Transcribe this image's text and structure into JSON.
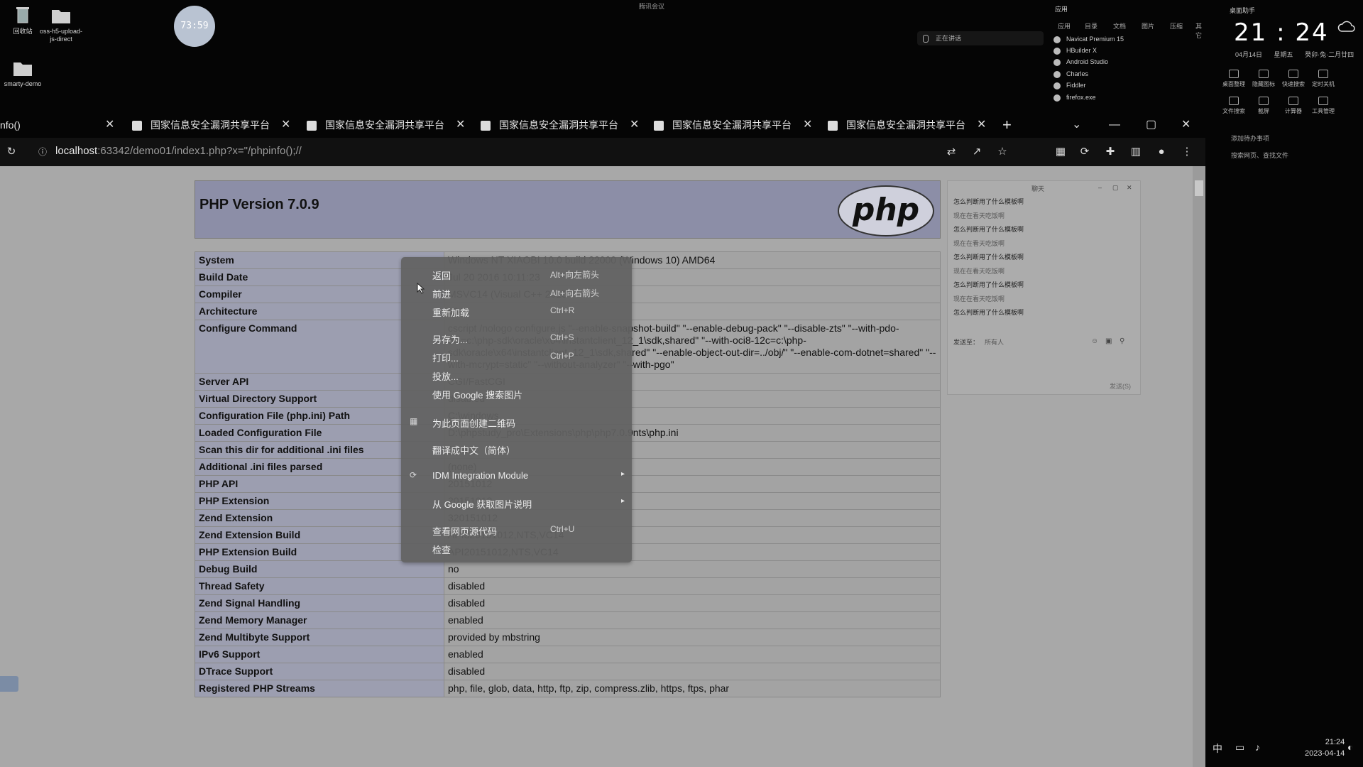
{
  "desktop": {
    "icons": [
      {
        "label": "回收站",
        "icon": "recycle-bin-icon"
      },
      {
        "label": "oss-h5-upload-js-direct",
        "icon": "folder-icon"
      },
      {
        "label": "smarty-demo",
        "icon": "folder-icon"
      }
    ],
    "timer": "73:59",
    "meeting_status": "腾讯会议",
    "sharing_status": "正在讲话"
  },
  "launcher": {
    "header": "应用",
    "tabs": [
      "应用",
      "目录",
      "文档",
      "图片",
      "压缩",
      "其它"
    ],
    "items": [
      "Navicat Premium 15",
      "HBuilder X",
      "Android Studio",
      "Charles",
      "Fiddler",
      "firefox.exe"
    ]
  },
  "right_panel": {
    "title": "桌面助手",
    "time": "21 : 24",
    "date": "04月14日",
    "weekday": "星期五",
    "lunar": "癸卯·兔·二月廿四",
    "tools_row1": [
      "桌面整理",
      "隐藏图标",
      "快速搜索",
      "定时关机"
    ],
    "tools_row2": [
      "文件搜索",
      "截屏",
      "计算器",
      "工具管理"
    ],
    "todo": "添加待办事项",
    "search": "搜索网页、查找文件"
  },
  "browser": {
    "first_tab": "nfo()",
    "tabs": [
      "国家信息安全漏洞共享平台",
      "国家信息安全漏洞共享平台",
      "国家信息安全漏洞共享平台",
      "国家信息安全漏洞共享平台",
      "国家信息安全漏洞共享平台"
    ],
    "new_tab": "+",
    "url_host": "localhost",
    "url_rest": ":63342/demo01/index1.php?x=\"/phpinfo();//"
  },
  "phpinfo": {
    "title": "PHP Version 7.0.9",
    "logo": "php",
    "rows": [
      {
        "k": "System",
        "v": "Windows NT XIAOBI 10.0 build 22000 (Windows 10) AMD64"
      },
      {
        "k": "Build Date",
        "v": "Jul 20 2016 10:11:23"
      },
      {
        "k": "Compiler",
        "v": "MSVC14 (Visual C++ 2015"
      },
      {
        "k": "Architecture",
        "v": "x64"
      },
      {
        "k": "Configure Command",
        "v": "cscript /nologo configure.js \"--enable-snapshot-build\" \"--enable-debug-pack\" \"--disable-zts\" \"--with-pdo-oci=c:\\php-sdk\\oracle\\x64\\instantclient_12_1\\sdk,shared\" \"--with-oci8-12c=c:\\php-sdk\\oracle\\x64\\instantclient_12_1\\sdk,shared\" \"--enable-object-out-dir=../obj/\" \"--enable-com-dotnet=shared\" \"--with-mcrypt=static\" \"--without-analyzer\" \"--with-pgo\""
      },
      {
        "k": "Server API",
        "v": "CGI/FastCGI"
      },
      {
        "k": "Virtual Directory Support",
        "v": "disabled"
      },
      {
        "k": "Configuration File (php.ini) Path",
        "v": "C:\\windows"
      },
      {
        "k": "Loaded Configuration File",
        "v": "D:\\phpstudy_pro\\Extensions\\php\\php7.0.9nts\\php.ini"
      },
      {
        "k": "Scan this dir for additional .ini files",
        "v": "(none)"
      },
      {
        "k": "Additional .ini files parsed",
        "v": "(none)"
      },
      {
        "k": "PHP API",
        "v": "20151012"
      },
      {
        "k": "PHP Extension",
        "v": "20151012"
      },
      {
        "k": "Zend Extension",
        "v": "320151012"
      },
      {
        "k": "Zend Extension Build",
        "v": "API320151012,NTS,VC14"
      },
      {
        "k": "PHP Extension Build",
        "v": "API20151012,NTS,VC14"
      },
      {
        "k": "Debug Build",
        "v": "no"
      },
      {
        "k": "Thread Safety",
        "v": "disabled"
      },
      {
        "k": "Zend Signal Handling",
        "v": "disabled"
      },
      {
        "k": "Zend Memory Manager",
        "v": "enabled"
      },
      {
        "k": "Zend Multibyte Support",
        "v": "provided by mbstring"
      },
      {
        "k": "IPv6 Support",
        "v": "enabled"
      },
      {
        "k": "DTrace Support",
        "v": "disabled"
      },
      {
        "k": "Registered PHP Streams",
        "v": "php, file, glob, data, http, ftp, zip, compress.zlib, https, ftps, phar"
      }
    ]
  },
  "chat": {
    "title": "聊天",
    "messages": [
      {
        "type": "q",
        "text": "怎么判断用了什么模板啊"
      },
      {
        "type": "a",
        "text": "现在在看天吃饭啊"
      },
      {
        "type": "q",
        "text": "怎么判断用了什么模板啊"
      },
      {
        "type": "a",
        "text": "现在在看天吃饭啊"
      },
      {
        "type": "q",
        "text": "怎么判断用了什么模板啊"
      },
      {
        "type": "a",
        "text": "现在在看天吃饭啊"
      },
      {
        "type": "q",
        "text": "怎么判断用了什么模板啊"
      },
      {
        "type": "a",
        "text": "现在在看天吃饭啊"
      },
      {
        "type": "q",
        "text": "怎么判断用了什么模板啊"
      }
    ],
    "send_to_label": "发送至：",
    "send_to_value": "所有人",
    "send_button": "发送(S)"
  },
  "context_menu": {
    "items": [
      {
        "label": "返回",
        "shortcut": "Alt+向左箭头"
      },
      {
        "label": "前进",
        "shortcut": "Alt+向右箭头"
      },
      {
        "label": "重新加载",
        "shortcut": "Ctrl+R"
      },
      {
        "label": "另存为...",
        "shortcut": "Ctrl+S"
      },
      {
        "label": "打印...",
        "shortcut": "Ctrl+P"
      },
      {
        "label": "投放...",
        "shortcut": ""
      },
      {
        "label": "使用 Google 搜索图片",
        "shortcut": ""
      },
      {
        "label": "为此页面创建二维码",
        "shortcut": ""
      },
      {
        "label": "翻译成中文（简体）",
        "shortcut": ""
      },
      {
        "label": "IDM Integration Module",
        "shortcut": ""
      },
      {
        "label": "从 Google 获取图片说明",
        "shortcut": ""
      },
      {
        "label": "查看网页源代码",
        "shortcut": "Ctrl+U"
      },
      {
        "label": "检查",
        "shortcut": ""
      }
    ]
  },
  "tray": {
    "ime": "中",
    "time": "21:24",
    "date": "2023-04-14"
  }
}
